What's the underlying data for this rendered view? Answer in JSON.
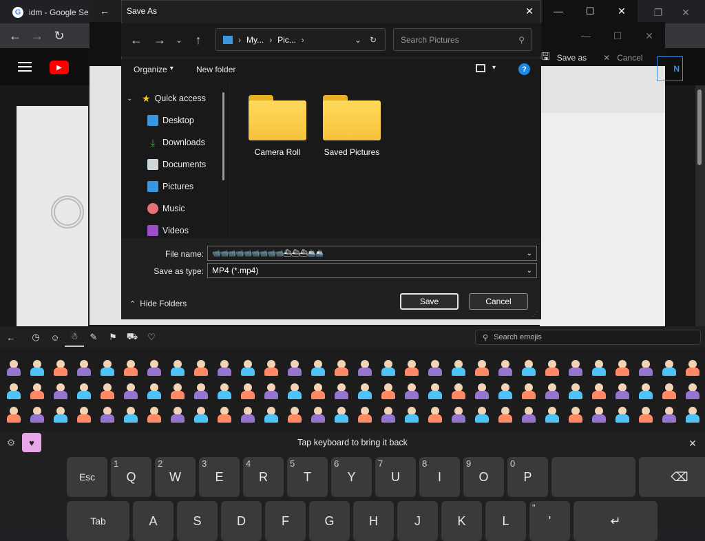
{
  "browser": {
    "tab_title": "idm - Google Se",
    "save_as_label": "Save as",
    "cancel_label": "Cancel"
  },
  "dialog": {
    "title": "Save As",
    "breadcrumb": [
      "My...",
      "Pic..."
    ],
    "search_placeholder": "Search Pictures",
    "organize_label": "Organize",
    "new_folder_label": "New folder",
    "nav_items": [
      {
        "label": "Quick access",
        "icon": "star-icon",
        "pinned": false
      },
      {
        "label": "Desktop",
        "icon": "desktop-icon",
        "pinned": true
      },
      {
        "label": "Downloads",
        "icon": "download-icon",
        "pinned": true
      },
      {
        "label": "Documents",
        "icon": "documents-icon",
        "pinned": true
      },
      {
        "label": "Pictures",
        "icon": "pictures-icon",
        "pinned": true
      },
      {
        "label": "Music",
        "icon": "music-icon",
        "pinned": false
      },
      {
        "label": "Videos",
        "icon": "videos-icon",
        "pinned": false
      }
    ],
    "folders": [
      "Camera Roll",
      "Saved Pictures"
    ],
    "file_name_label": "File name:",
    "file_name_value": "📹📹📹📹📹📹📹📹📹⛴⛴⛴🚢🚢",
    "save_type_label": "Save as type:",
    "save_type_value": "MP4 (*.mp4)",
    "hide_folders_label": "Hide Folders",
    "save_label": "Save",
    "cancel_label": "Cancel",
    "colors": {
      "folder": "#f6c23b",
      "accent": "#3a96dd"
    }
  },
  "emoji_panel": {
    "search_placeholder": "Search emojis",
    "tabs": [
      "back-icon",
      "recent-icon",
      "smiley-icon",
      "people-icon",
      "celebration-icon",
      "food-icon",
      "transport-icon",
      "heart-icon"
    ],
    "rows": 3,
    "per_row": 30
  },
  "keyboard": {
    "message": "Tap keyboard to bring it back",
    "row1": [
      {
        "label": "Esc",
        "num": ""
      },
      {
        "label": "Q",
        "num": "1"
      },
      {
        "label": "W",
        "num": "2"
      },
      {
        "label": "E",
        "num": "3"
      },
      {
        "label": "R",
        "num": "4"
      },
      {
        "label": "T",
        "num": "5"
      },
      {
        "label": "Y",
        "num": "6"
      },
      {
        "label": "U",
        "num": "7"
      },
      {
        "label": "I",
        "num": "8"
      },
      {
        "label": "O",
        "num": "9"
      },
      {
        "label": "P",
        "num": "0"
      },
      {
        "label": "",
        "num": ""
      },
      {
        "label": "⌫",
        "num": ""
      }
    ],
    "row2": [
      {
        "label": "Tab",
        "num": ""
      },
      {
        "label": "A",
        "num": ""
      },
      {
        "label": "S",
        "num": ""
      },
      {
        "label": "D",
        "num": ""
      },
      {
        "label": "F",
        "num": ""
      },
      {
        "label": "G",
        "num": ""
      },
      {
        "label": "H",
        "num": ""
      },
      {
        "label": "J",
        "num": ""
      },
      {
        "label": "K",
        "num": ""
      },
      {
        "label": "L",
        "num": ""
      },
      {
        "label": "'",
        "num": "\""
      },
      {
        "label": "↵",
        "num": ""
      }
    ]
  }
}
